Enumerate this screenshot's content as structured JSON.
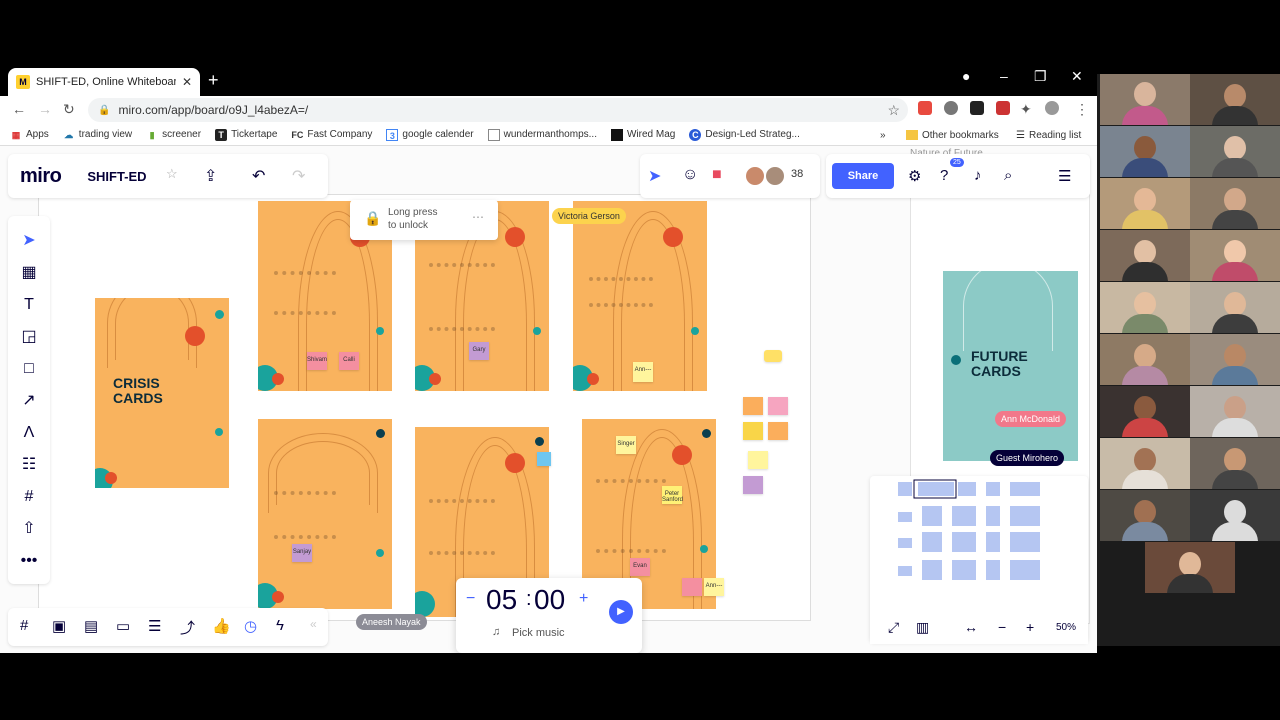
{
  "browser": {
    "tab_title": "SHIFT-ED, Online Whiteboard fo",
    "tab_favicon": "M",
    "url": "miro.com/app/board/o9J_l4abezA=/",
    "bookmarks": [
      {
        "label": "Apps",
        "icon": "apps-icon"
      },
      {
        "label": "trading view",
        "icon": "cloud-icon"
      },
      {
        "label": "screener",
        "icon": "bars-icon"
      },
      {
        "label": "Tickertape",
        "icon": "ticker-icon"
      },
      {
        "label": "Fast Company",
        "icon": "fc-icon"
      },
      {
        "label": "google calender",
        "icon": "calendar-icon"
      },
      {
        "label": "wundermanthomps...",
        "icon": "page-icon"
      },
      {
        "label": "Wired Mag",
        "icon": "wired-icon"
      },
      {
        "label": "Design-Led Strateg...",
        "icon": "c-icon"
      }
    ],
    "other_bookmarks": "Other bookmarks",
    "reading_list": "Reading list",
    "chevron": "»"
  },
  "miro": {
    "logo": "miro",
    "board_name": "SHIFT-ED",
    "collaborator_count": "38",
    "share_label": "Share",
    "notification_badge": "25",
    "faded_frame_title": "Nature of Future",
    "lock_popup": {
      "line1": "Long press",
      "line2": "to unlock"
    },
    "crisis_title": "CRISIS CARDS",
    "future_title": "FUTURE CARDS",
    "cursors": {
      "victoria": "Victoria Gerson",
      "ann": "Ann McDonald",
      "guest": "Guest Mirohero",
      "aneesh": "Aneesh Nayak"
    },
    "stickies": {
      "s1": "Shivam",
      "s2": "Calli",
      "s3": "Gary",
      "s4": "Ann---",
      "s5": "Sanjay",
      "s6": "Evan",
      "s7": "Singer",
      "s8": "Peter Sanford",
      "s9": "Ann---"
    },
    "timer": {
      "minutes": "05",
      "seconds": "00",
      "music": "Pick music"
    },
    "zoom": "50%",
    "colors": {
      "card": "#f9b35e",
      "teal": "#8ccac6",
      "accent": "#4262ff",
      "red": "#e3502b"
    }
  }
}
